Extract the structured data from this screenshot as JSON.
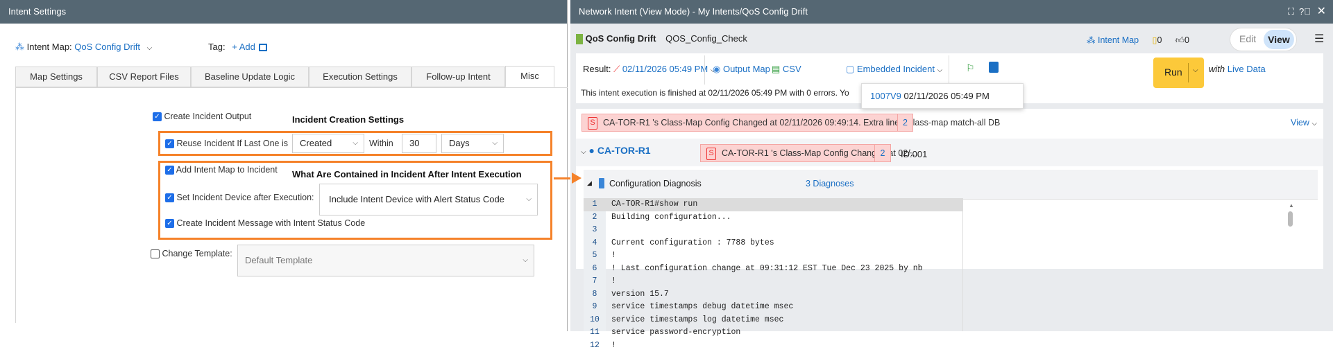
{
  "left": {
    "title": "Intent Settings",
    "intent_map_label": "Intent Map:",
    "intent_map_value": "QoS Config Drift",
    "tag_label": "Tag:",
    "tag_add": "+ Add",
    "tabs": [
      "Map Settings",
      "CSV Report Files",
      "Baseline Update Logic",
      "Execution Settings",
      "Follow-up Intent",
      "Misc"
    ],
    "active_tab": "Misc",
    "create_incident_output": "Create Incident Output",
    "incident_creation_heading": "Incident Creation Settings",
    "reuse_label": "Reuse Incident If Last One is",
    "reuse_state": "Created",
    "within_label": "Within",
    "within_value": "30",
    "within_unit": "Days",
    "add_map_label": "Add Intent Map to Incident",
    "contents_heading": "What Are Contained in Incident After Intent Execution",
    "set_device_label": "Set Incident Device after Execution:",
    "set_device_value": "Include Intent Device with Alert Status Code",
    "create_message_label": "Create Incident Message with Intent Status Code",
    "change_template_label": "Change Template:",
    "template_value": "Default Template"
  },
  "right": {
    "title": "Network Intent (View Mode) - My Intents/QoS Config Drift",
    "intent_name": "QoS Config Drift",
    "intent_sub": "QOS_Config_Check",
    "intent_map_link": "Intent Map",
    "doc_count": "0",
    "like_count": "0",
    "edit_label": "Edit",
    "view_label": "View",
    "result_label": "Result:",
    "result_value": "02/11/2026 05:49 PM",
    "output_map": "Output Map",
    "csv": "CSV",
    "embedded_incident": "Embedded Incident",
    "run": "Run",
    "with": "with",
    "live_data": "Live Data",
    "status_message": "This intent execution is finished at 02/11/2026 05:49 PM with 0 errors. Yo",
    "popup_id": "1007V9",
    "popup_time": "02/11/2026 05:49 PM",
    "banner_badge": "S",
    "banner_text": "CA-TOR-R1 's Class-Map Config Changed at 02/11/2026 09:49:14. Extra lines: class-map match-all DB",
    "banner_count": "2",
    "view_link": "View",
    "device_name": "CA-TOR-R1",
    "device_alert": "CA-TOR-R1 's Class-Map Config Changed at 02/...",
    "device_count": "2",
    "device_id": "ID:001",
    "diagnosis_title": "Configuration Diagnosis",
    "diagnoses_link": "3 Diagnoses",
    "code_lines": [
      {
        "n": "1",
        "t": "CA-TOR-R1#show run"
      },
      {
        "n": "2",
        "t": "Building configuration..."
      },
      {
        "n": "3",
        "t": ""
      },
      {
        "n": "4",
        "t": "Current configuration : 7788 bytes"
      },
      {
        "n": "5",
        "t": "!"
      },
      {
        "n": "6",
        "t": "! Last configuration change at 09:31:12 EST Tue Dec 23 2025 by nb"
      },
      {
        "n": "7",
        "t": "!"
      },
      {
        "n": "8",
        "t": "version 15.7"
      },
      {
        "n": "9",
        "t": "service timestamps debug datetime msec"
      },
      {
        "n": "10",
        "t": "service timestamps log datetime msec"
      },
      {
        "n": "11",
        "t": "service password-encryption"
      },
      {
        "n": "12",
        "t": "!"
      }
    ]
  }
}
